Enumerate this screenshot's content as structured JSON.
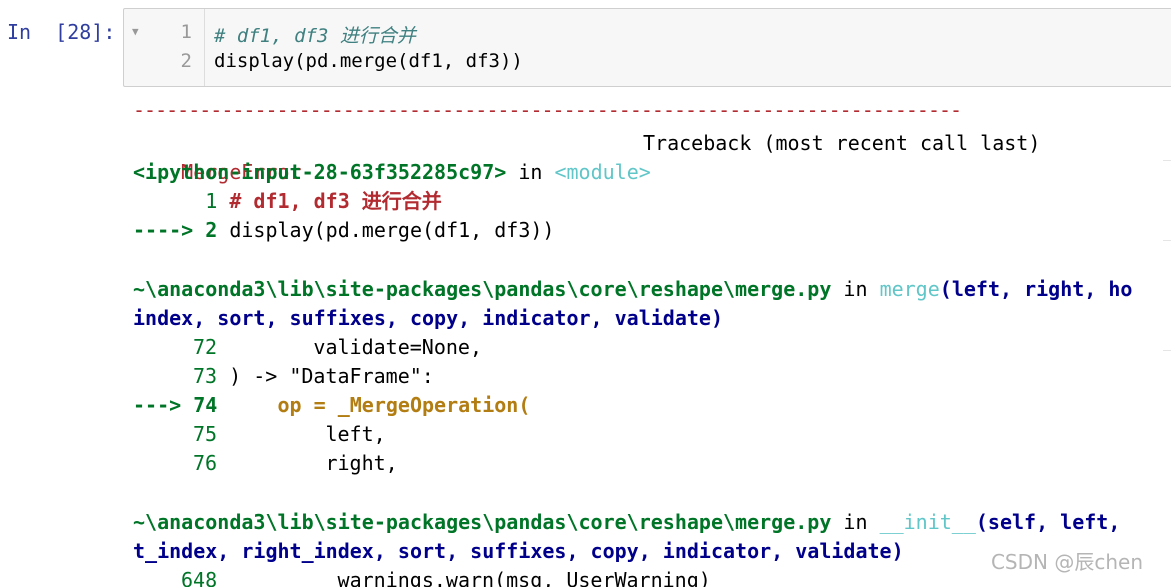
{
  "cell": {
    "prompt": "In  [28]:",
    "line_numbers": [
      "1",
      "2"
    ],
    "code": {
      "comment": "# df1, df3 进行合并",
      "line2": "display(pd.merge(df1, df3))"
    }
  },
  "traceback": {
    "separator": "---------------------------------------------------------------------------",
    "error_name": "MergeError",
    "header_right": "Traceback (most recent call last)",
    "frame1": {
      "location": "<ipython-input-28-63f352285c97>",
      "in": " in ",
      "func": "<module>",
      "lines": [
        {
          "prefix": "      1 ",
          "code": "# df1, df3 进行合并"
        },
        {
          "prefix": "----> 2 ",
          "code": "display(pd.merge(df1, df3))"
        }
      ]
    },
    "frame2": {
      "path": "~\\anaconda3\\lib\\site-packages\\pandas\\core\\reshape\\merge.py",
      "in": " in ",
      "func": "merge",
      "args1": "(left, right, ho",
      "args2": "index, sort, suffixes, copy, indicator, validate)",
      "lines": [
        {
          "num": "72",
          "code": "        validate=None,"
        },
        {
          "num": "73",
          "code": " ) -> \"DataFrame\":"
        },
        {
          "num": "74",
          "code": "     op = _MergeOperation("
        },
        {
          "num": "75",
          "code": "         left,"
        },
        {
          "num": "76",
          "code": "         right,"
        }
      ],
      "arrow": "---> "
    },
    "frame3": {
      "path": "~\\anaconda3\\lib\\site-packages\\pandas\\core\\reshape\\merge.py",
      "in": " in ",
      "func": "__init__",
      "args1": "(self, left,",
      "args2": "t_index, right_index, sort, suffixes, copy, indicator, validate)",
      "line_num": "648",
      "line_code": "          warnings.warn(msg, UserWarning)"
    }
  },
  "watermark": "CSDN @辰chen",
  "colors": {
    "error_red": "#b22b31",
    "lineno_green": "#007427",
    "func_cyan": "#60c6c8",
    "current_line_yellow": "#b27d12",
    "prompt_blue": "#303f9f"
  }
}
